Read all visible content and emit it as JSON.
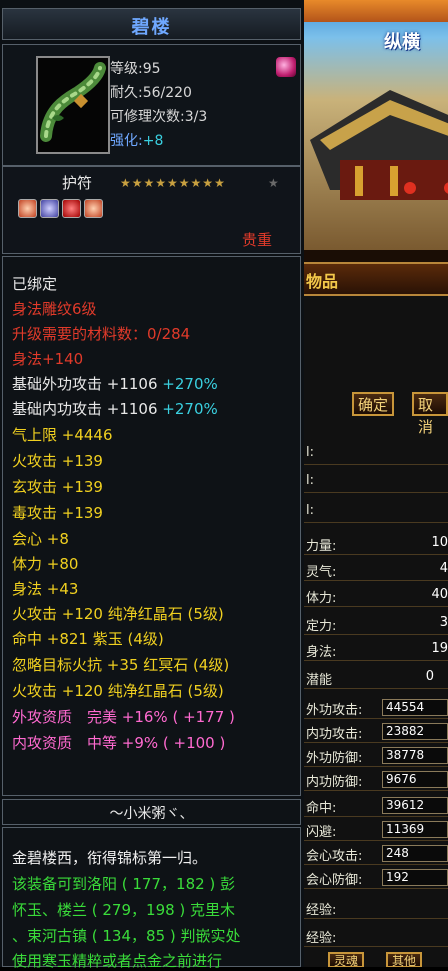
{
  "item": {
    "name": "碧楼",
    "level": "等级:95",
    "durability": "耐久:56/220",
    "repair": "可修理次数:3/3",
    "enhance_label": "强化:",
    "enhance_value": "+8",
    "rune_label": "护符",
    "rune_stars": "★★★★★★★★★",
    "rarity": "贵重"
  },
  "attributes": {
    "bound": "已绑定",
    "carve": "身法雕纹6级",
    "upgrade": "升级需要的材料数：0/284",
    "agility_main": "身法+140",
    "base_outer_label": "基础外功攻击 +1106",
    "base_outer_pct": "+270%",
    "base_inner_label": "基础内功攻击 +1106",
    "base_inner_pct": "+270%",
    "hp": "气上限 +4446",
    "fire": "火攻击 +139",
    "mystic": "玄攻击 +139",
    "poison": "毒攻击 +139",
    "crit": "会心 +8",
    "stamina": "体力 +80",
    "agility": "身法 +43",
    "gem1": "火攻击 +120 纯净红晶石 (5级)",
    "gem2": "命中 +821 紫玉 (4级)",
    "gem3": "忽略目标火抗 +35 红冥石 (4级)",
    "gem4": "火攻击 +120 纯净红晶石 (5级)",
    "apt_outer": "外攻资质　完美 +16% ( +177 )",
    "apt_inner": "内攻资质　中等 +9% ( +100 )"
  },
  "signer": "～小米粥ヾ、",
  "description": {
    "line1": "金碧楼西，衔得锦标第一归。",
    "line2": "该装备可到洛阳 ( 177，182 ) 彭",
    "line3": "怀玉、楼兰 ( 279，198 ) 克里木",
    "line4": "、束河古镇 ( 134，85 ) 判嵌实处",
    "line5": "使用寒玉精粹或者点金之前进行"
  },
  "scene": {
    "title": "纵横",
    "panel_title": "物品",
    "confirm": "确定",
    "cancel": "取消",
    "rows": [
      {
        "label": "力量:",
        "value": "10"
      },
      {
        "label": "灵气:",
        "value": "4"
      },
      {
        "label": "体力:",
        "value": "40"
      },
      {
        "label": "定力:",
        "value": "3"
      },
      {
        "label": "身法:",
        "value": "19"
      },
      {
        "label": "潜能",
        "value": "0"
      }
    ],
    "boxes": [
      {
        "label": "外功攻击:",
        "value": "44554"
      },
      {
        "label": "内功攻击:",
        "value": "23882"
      },
      {
        "label": "外功防御:",
        "value": "38778"
      },
      {
        "label": "内功防御:",
        "value": "9676"
      },
      {
        "label": "命中:",
        "value": "39612"
      },
      {
        "label": "闪避:",
        "value": "11369"
      },
      {
        "label": "会心攻击:",
        "value": "248"
      },
      {
        "label": "会心防御:",
        "value": "192"
      }
    ],
    "exp1": "经验:",
    "exp2": "经验:",
    "bottom1": "灵魂",
    "bottom2": "其他"
  }
}
